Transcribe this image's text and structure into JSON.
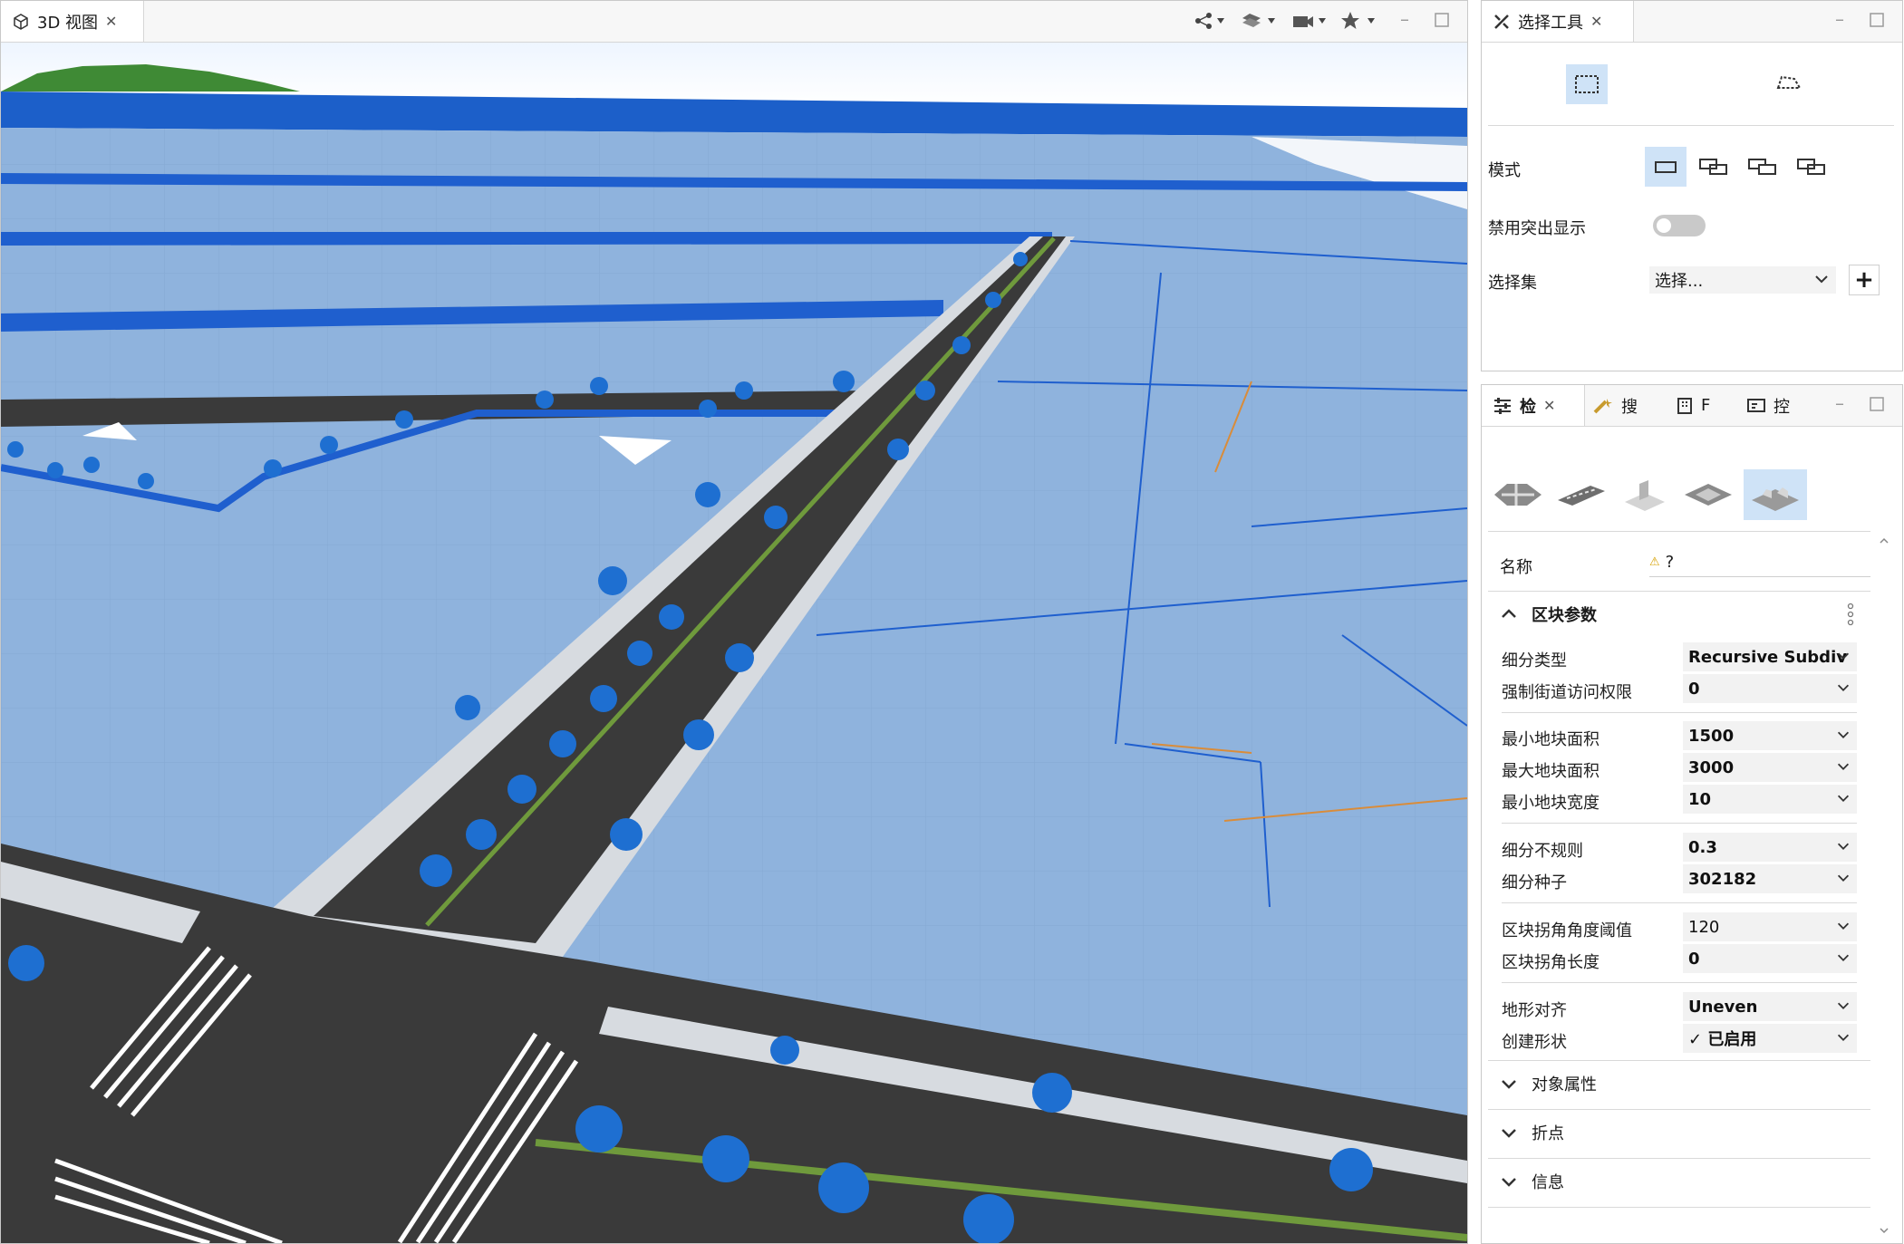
{
  "view3d": {
    "tab_label": "3D 视图",
    "tab_close": "✕"
  },
  "select_tool": {
    "tab_label": "选择工具",
    "mode_label": "模式",
    "highlight_label": "禁用突出显示",
    "selection_set_label": "选择集",
    "selection_set_value": "选择...",
    "add_label": "+"
  },
  "inspector": {
    "tabs": [
      {
        "label": "检"
      },
      {
        "label": "搜"
      },
      {
        "label": "F"
      },
      {
        "label": "控"
      }
    ],
    "name_label": "名称",
    "name_value": "?",
    "block_section": "区块参数",
    "params": [
      {
        "label": "细分类型",
        "value": "Recursive Subdiv"
      },
      {
        "label": "强制街道访问权限",
        "value": "0"
      },
      {
        "label": "最小地块面积",
        "value": "1500"
      },
      {
        "label": "最大地块面积",
        "value": "3000"
      },
      {
        "label": "最小地块宽度",
        "value": "10"
      },
      {
        "label": "细分不规则",
        "value": "0.3"
      },
      {
        "label": "细分种子",
        "value": "302182"
      },
      {
        "label": "区块拐角角度阈值",
        "value": "120"
      },
      {
        "label": "区块拐角长度",
        "value": "0"
      },
      {
        "label": "地形对齐",
        "value": "Uneven"
      },
      {
        "label": "创建形状",
        "value": "✓ 已启用"
      }
    ],
    "sections": [
      {
        "label": "对象属性"
      },
      {
        "label": "折点"
      },
      {
        "label": "信息"
      }
    ]
  },
  "colors": {
    "accent": "#cfe3f7",
    "road": "#3a3a3a",
    "lot": "#8fb3d9",
    "wire": "#1a5fcf",
    "tree": "#1e6fd1"
  }
}
